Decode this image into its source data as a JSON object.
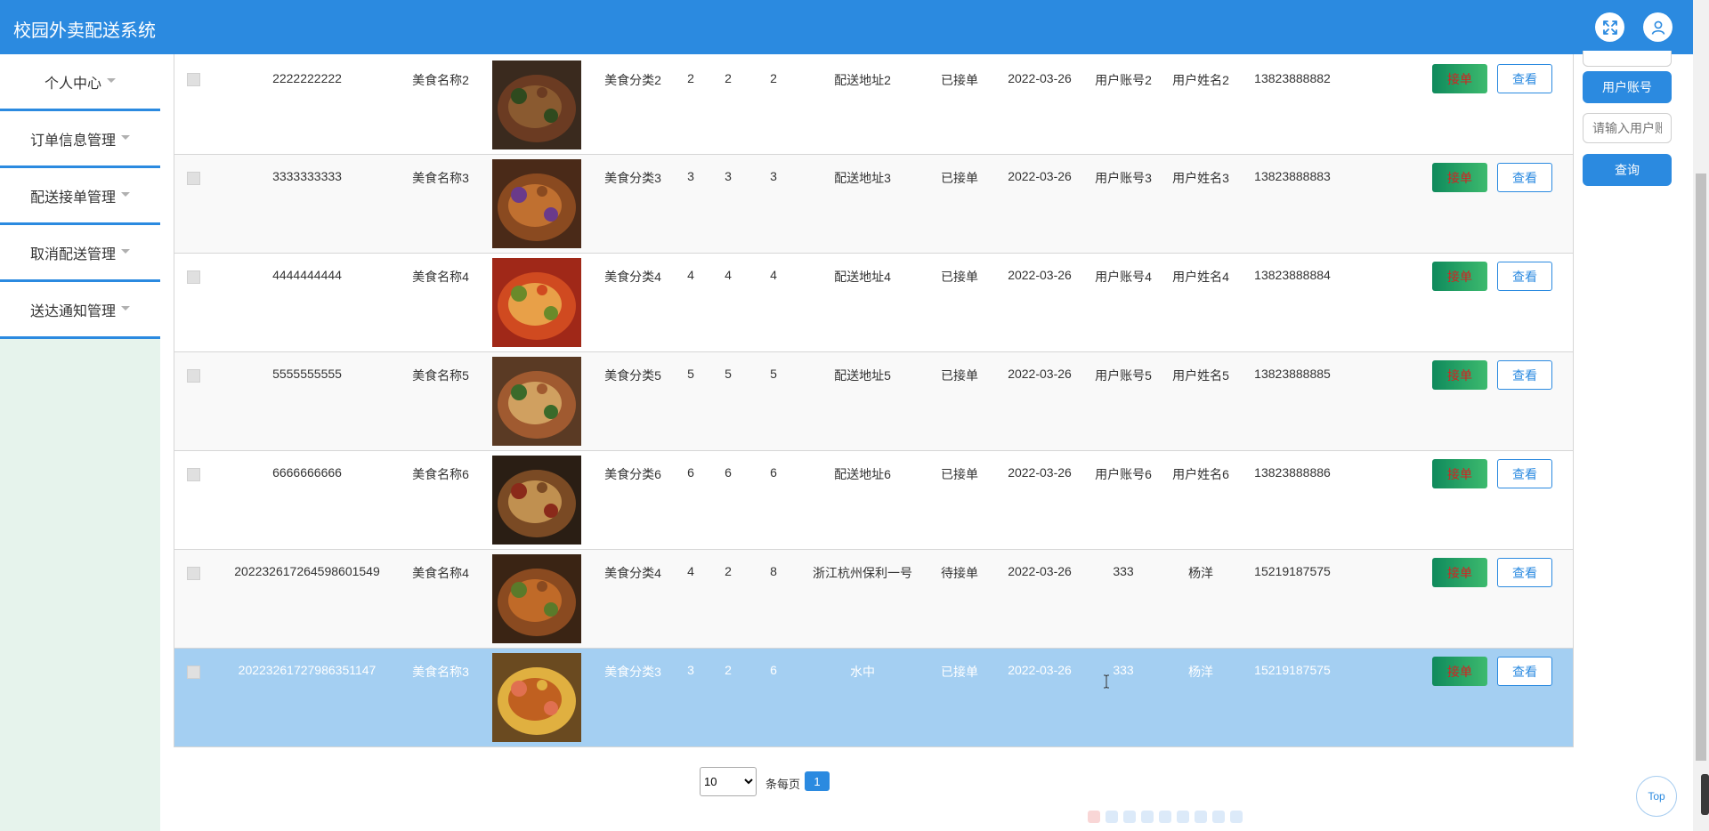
{
  "app": {
    "title": "校园外卖配送系统"
  },
  "header": {
    "fullscreen_icon": "expand-arrows-icon",
    "user_icon": "user-icon"
  },
  "sidebar": {
    "items": [
      {
        "label": "个人中心"
      },
      {
        "label": "订单信息管理"
      },
      {
        "label": "配送接单管理"
      },
      {
        "label": "取消配送管理"
      },
      {
        "label": "送达通知管理"
      }
    ]
  },
  "right_panel": {
    "account_button": "用户账号",
    "input_placeholder": "请输入用户账号",
    "query_button": "查询"
  },
  "table": {
    "accept_label": "接单",
    "view_label": "查看",
    "rows": [
      {
        "order_no": "2222222222",
        "food_name": "美食名称2",
        "food_category": "美食分类2",
        "c1": "2",
        "c2": "2",
        "c3": "2",
        "address": "配送地址2",
        "status": "已接单",
        "date": "2022-03-26",
        "account": "用户账号2",
        "user_name": "用户姓名2",
        "phone": "13823888882"
      },
      {
        "order_no": "3333333333",
        "food_name": "美食名称3",
        "food_category": "美食分类3",
        "c1": "3",
        "c2": "3",
        "c3": "3",
        "address": "配送地址3",
        "status": "已接单",
        "date": "2022-03-26",
        "account": "用户账号3",
        "user_name": "用户姓名3",
        "phone": "13823888883"
      },
      {
        "order_no": "4444444444",
        "food_name": "美食名称4",
        "food_category": "美食分类4",
        "c1": "4",
        "c2": "4",
        "c3": "4",
        "address": "配送地址4",
        "status": "已接单",
        "date": "2022-03-26",
        "account": "用户账号4",
        "user_name": "用户姓名4",
        "phone": "13823888884"
      },
      {
        "order_no": "5555555555",
        "food_name": "美食名称5",
        "food_category": "美食分类5",
        "c1": "5",
        "c2": "5",
        "c3": "5",
        "address": "配送地址5",
        "status": "已接单",
        "date": "2022-03-26",
        "account": "用户账号5",
        "user_name": "用户姓名5",
        "phone": "13823888885"
      },
      {
        "order_no": "6666666666",
        "food_name": "美食名称6",
        "food_category": "美食分类6",
        "c1": "6",
        "c2": "6",
        "c3": "6",
        "address": "配送地址6",
        "status": "已接单",
        "date": "2022-03-26",
        "account": "用户账号6",
        "user_name": "用户姓名6",
        "phone": "13823888886"
      },
      {
        "order_no": "20223261726459860​1549",
        "food_name": "美食名称4",
        "food_category": "美食分类4",
        "c1": "4",
        "c2": "2",
        "c3": "8",
        "address": "浙江杭州保利一号",
        "status": "待接单",
        "date": "2022-03-26",
        "account": "333",
        "user_name": "杨洋",
        "phone": "15219187575"
      },
      {
        "order_no": "20223261727986351147",
        "food_name": "美食名称3",
        "food_category": "美食分类3",
        "c1": "3",
        "c2": "2",
        "c3": "6",
        "address": "水中",
        "status": "已接单",
        "date": "2022-03-26",
        "account": "333",
        "user_name": "杨洋",
        "phone": "15219187575"
      }
    ]
  },
  "pagination": {
    "page_size": "10",
    "page_size_options": [
      "10"
    ],
    "per_page_label": "条每页",
    "current_page": "1"
  },
  "back_to_top": "Top",
  "colors": {
    "primary": "#2b8ae0",
    "sidebar_bg": "#e6f3ec",
    "selected_row": "#a4cff2",
    "accept_text": "#d32222"
  }
}
